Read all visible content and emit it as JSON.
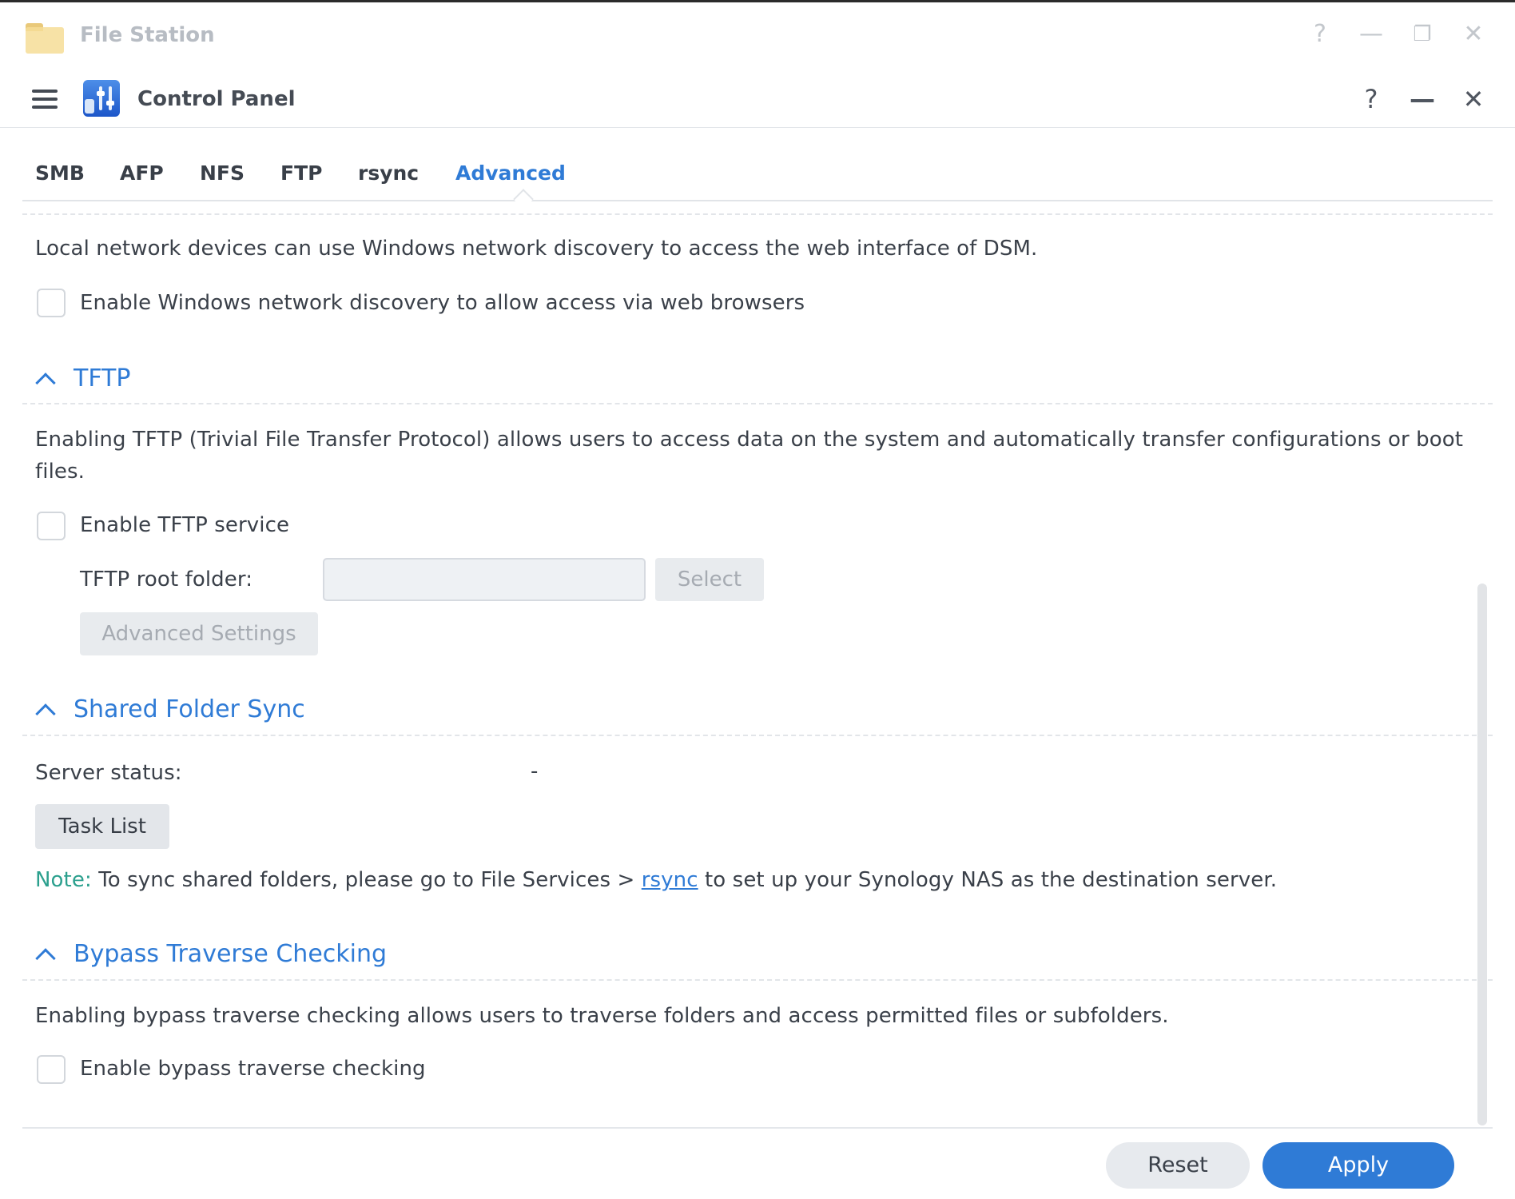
{
  "background_window": {
    "title": "File Station",
    "controls": {
      "help": "?",
      "minimize": "—",
      "restore": "❐",
      "close": "✕"
    }
  },
  "window": {
    "title": "Control Panel",
    "controls": {
      "help": "?",
      "minimize": "—",
      "close": "✕"
    }
  },
  "tabs": [
    {
      "label": "SMB"
    },
    {
      "label": "AFP"
    },
    {
      "label": "NFS"
    },
    {
      "label": "FTP"
    },
    {
      "label": "rsync"
    },
    {
      "label": "Advanced",
      "active": true
    }
  ],
  "wsd": {
    "description": "Local network devices can use Windows network discovery to access the web interface of DSM.",
    "checkbox_label": "Enable Windows network discovery to allow access via web browsers",
    "checked": false
  },
  "tftp": {
    "heading": "TFTP",
    "description": "Enabling TFTP (Trivial File Transfer Protocol) allows users to access data on the system and automatically transfer configurations or boot files.",
    "checkbox_label": "Enable TFTP service",
    "checked": false,
    "root_folder_label": "TFTP root folder:",
    "root_folder_value": "",
    "select_button": "Select",
    "advanced_button": "Advanced Settings"
  },
  "shared_folder_sync": {
    "heading": "Shared Folder Sync",
    "server_status_label": "Server status:",
    "server_status_value": "-",
    "task_list_button": "Task List",
    "note_label": "Note:",
    "note_before": "To sync shared folders, please go to File Services >",
    "note_link": "rsync",
    "note_after": "to set up your Synology NAS as the destination server."
  },
  "bypass_traverse": {
    "heading": "Bypass Traverse Checking",
    "description": "Enabling bypass traverse checking allows users to traverse folders and access permitted files or subfolders.",
    "checkbox_label": "Enable bypass traverse checking",
    "checked": false
  },
  "footer": {
    "reset_button": "Reset",
    "apply_button": "Apply"
  },
  "colors": {
    "accent": "#2f7bd6",
    "note_green": "#2ca08e"
  }
}
